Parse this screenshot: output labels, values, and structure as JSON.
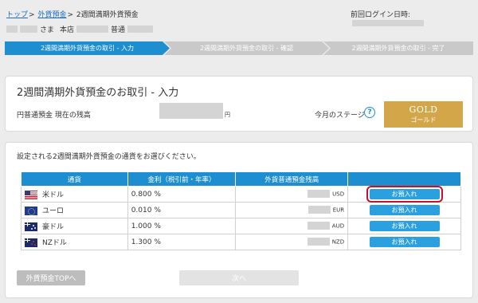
{
  "breadcrumb": {
    "top": "トップ",
    "foreign": "外貨預金",
    "current": "2週間満期外貨預金",
    "separator": ">"
  },
  "header": {
    "last_login_label": "前回ログイン日時:",
    "honorific": "さま",
    "branch_label": "本店",
    "account_type": "普通"
  },
  "steps": [
    {
      "label": "2週間満期外貨預金の取引 - 入力",
      "active": true
    },
    {
      "label": "2週間満期外貨預金の取引 - 確認",
      "active": false
    },
    {
      "label": "2週間満期外貨預金の取引 - 完了",
      "active": false
    }
  ],
  "panel": {
    "title": "2週間満期外貨預金のお取引 - 入力",
    "balance_label": "円普通預金 現在の残高",
    "balance_unit": "円",
    "stage_label": "今月のステージ",
    "help_icon": "?",
    "stage_name": "GOLD",
    "stage_name_jp": "ゴールド"
  },
  "select_panel": {
    "instruction": "設定される2週間満期外貨預金の通貨をお選びください。",
    "headers": [
      "通貨",
      "金利（税引前・年率）",
      "外貨普通預金残高",
      ""
    ],
    "rows": [
      {
        "flag": "us-flag-icon",
        "currency": "米ドル",
        "rate": "0.800 %",
        "unit": "USD",
        "button": "お預入れ",
        "selected": true
      },
      {
        "flag": "eu-flag-icon",
        "currency": "ユーロ",
        "rate": "0.010 %",
        "unit": "EUR",
        "button": "お預入れ",
        "selected": false
      },
      {
        "flag": "au-flag-icon",
        "currency": "豪ドル",
        "rate": "1.000 %",
        "unit": "AUD",
        "button": "お預入れ",
        "selected": false
      },
      {
        "flag": "nz-flag-icon",
        "currency": "NZドル",
        "rate": "1.300 %",
        "unit": "NZD",
        "button": "お預入れ",
        "selected": false
      }
    ],
    "back_button": "外貨預金TOPへ",
    "next_button": "次へ"
  },
  "colors": {
    "accent": "#1d8ed0",
    "gold": "#d4a64a",
    "highlight": "#c8102e"
  }
}
